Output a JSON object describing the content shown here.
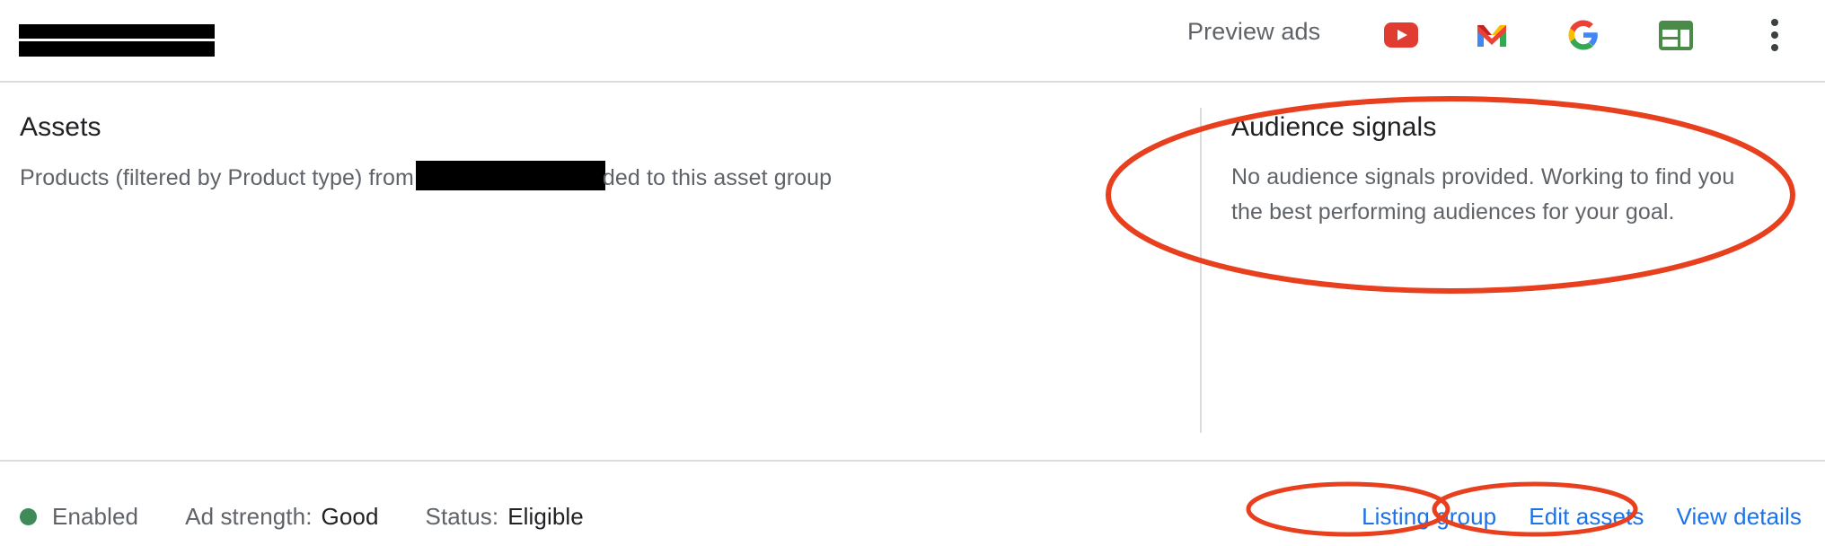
{
  "header": {
    "account_redacted": true,
    "preview_ads_label": "Preview ads",
    "icons": [
      {
        "name": "youtube-icon",
        "label": "YouTube"
      },
      {
        "name": "gmail-icon",
        "label": "Gmail"
      },
      {
        "name": "google-search-icon",
        "label": "Google Search"
      },
      {
        "name": "display-icon",
        "label": "Display"
      },
      {
        "name": "more-options-icon",
        "label": "More options"
      }
    ]
  },
  "assets": {
    "title": "Assets",
    "description_before": "Products (filtered by Product type) from",
    "description_after": "ded to this asset group",
    "redacted": true
  },
  "audience": {
    "title": "Audience signals",
    "body": "No audience signals provided. Working to find you the best performing audiences for your goal."
  },
  "status_bar": {
    "enabled_label": "Enabled",
    "enabled_dot_color": "#3f8a55",
    "ad_strength_label": "Ad strength:",
    "ad_strength_value": "Good",
    "status_label": "Status:",
    "status_value": "Eligible",
    "links": [
      {
        "name": "listing-group-link",
        "label": "Listing group"
      },
      {
        "name": "edit-assets-link",
        "label": "Edit assets"
      },
      {
        "name": "view-details-link",
        "label": "View details"
      }
    ]
  },
  "annotations": {
    "color": "#e8401f",
    "shapes": [
      {
        "name": "audience-signals-highlight",
        "target": "Audience signals"
      },
      {
        "name": "listing-group-highlight",
        "target": "Listing group"
      },
      {
        "name": "edit-assets-highlight",
        "target": "Edit assets"
      }
    ]
  }
}
